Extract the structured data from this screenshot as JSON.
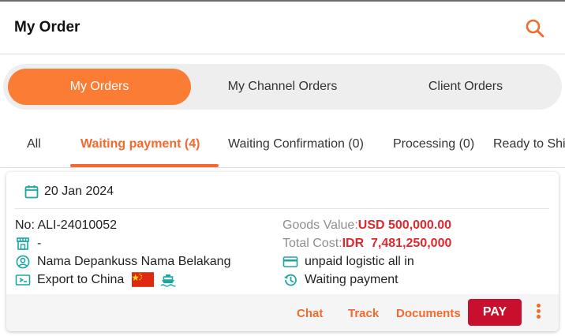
{
  "header": {
    "title": "My Order",
    "search_icon": "search-icon"
  },
  "segments": [
    {
      "label": "My Orders",
      "active": true
    },
    {
      "label": "My Channel Orders",
      "active": false
    },
    {
      "label": "Client Orders",
      "active": false
    }
  ],
  "tabs": [
    {
      "label": "All",
      "active": false
    },
    {
      "label": "Waiting payment (4)",
      "active": true
    },
    {
      "label": "Waiting Confirmation (0)",
      "active": false
    },
    {
      "label": "Processing (0)",
      "active": false
    },
    {
      "label": "Ready to Shi",
      "active": false
    }
  ],
  "order": {
    "date": "20 Jan 2024",
    "number": "No: ALI-24010052",
    "store": "-",
    "customer": "Nama Depankuss Nama Belakang",
    "export": "Export to China",
    "goods_label": "Goods Value: ",
    "goods_value": "USD 500,000.00",
    "total_label": "Total Cost: ",
    "total_value": "IDR  7,481,250,000",
    "logistic": "unpaid logistic all in",
    "status": "Waiting payment"
  },
  "actions": {
    "chat": "Chat",
    "track": "Track",
    "documents": "Documents",
    "pay": "PAY"
  },
  "colors": {
    "accent": "#fb7d35",
    "accent_text": "#f26a2e",
    "teal": "#1aa7a2",
    "pay": "#c8102e",
    "value_red": "#e0282e"
  }
}
